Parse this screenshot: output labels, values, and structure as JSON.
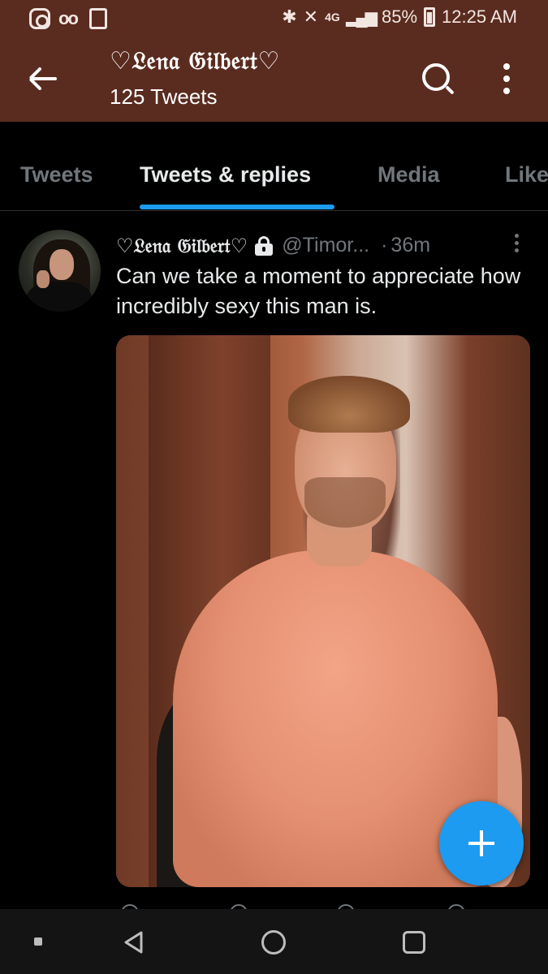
{
  "status_bar": {
    "battery": "85%",
    "time": "12:25 AM",
    "network": "4G",
    "icons": [
      "instagram-icon",
      "voicemail-icon",
      "notification-icon",
      "bluetooth-icon",
      "mute-icon",
      "signal-icon",
      "battery-icon"
    ]
  },
  "header": {
    "title": "♡𝔏𝔢𝔫𝔞 𝔊𝔦𝔩𝔟𝔢𝔯𝔱♡",
    "subtitle": "125 Tweets"
  },
  "tabs": [
    {
      "label": "Tweets",
      "active": false
    },
    {
      "label": "Tweets & replies",
      "active": true
    },
    {
      "label": "Media",
      "active": false
    },
    {
      "label": "Likes",
      "active": false
    }
  ],
  "tweet": {
    "name": "♡𝔏𝔢𝔫𝔞 𝔊𝔦𝔩𝔟𝔢𝔯𝔱♡",
    "handle": "@Timor...",
    "dot": "·",
    "time": "36m",
    "text": "Can we take a moment to appreciate how incredibly sexy this man is."
  },
  "colors": {
    "header_bg": "#5a2b1f",
    "accent": "#1d9bf0",
    "background": "#000000"
  }
}
